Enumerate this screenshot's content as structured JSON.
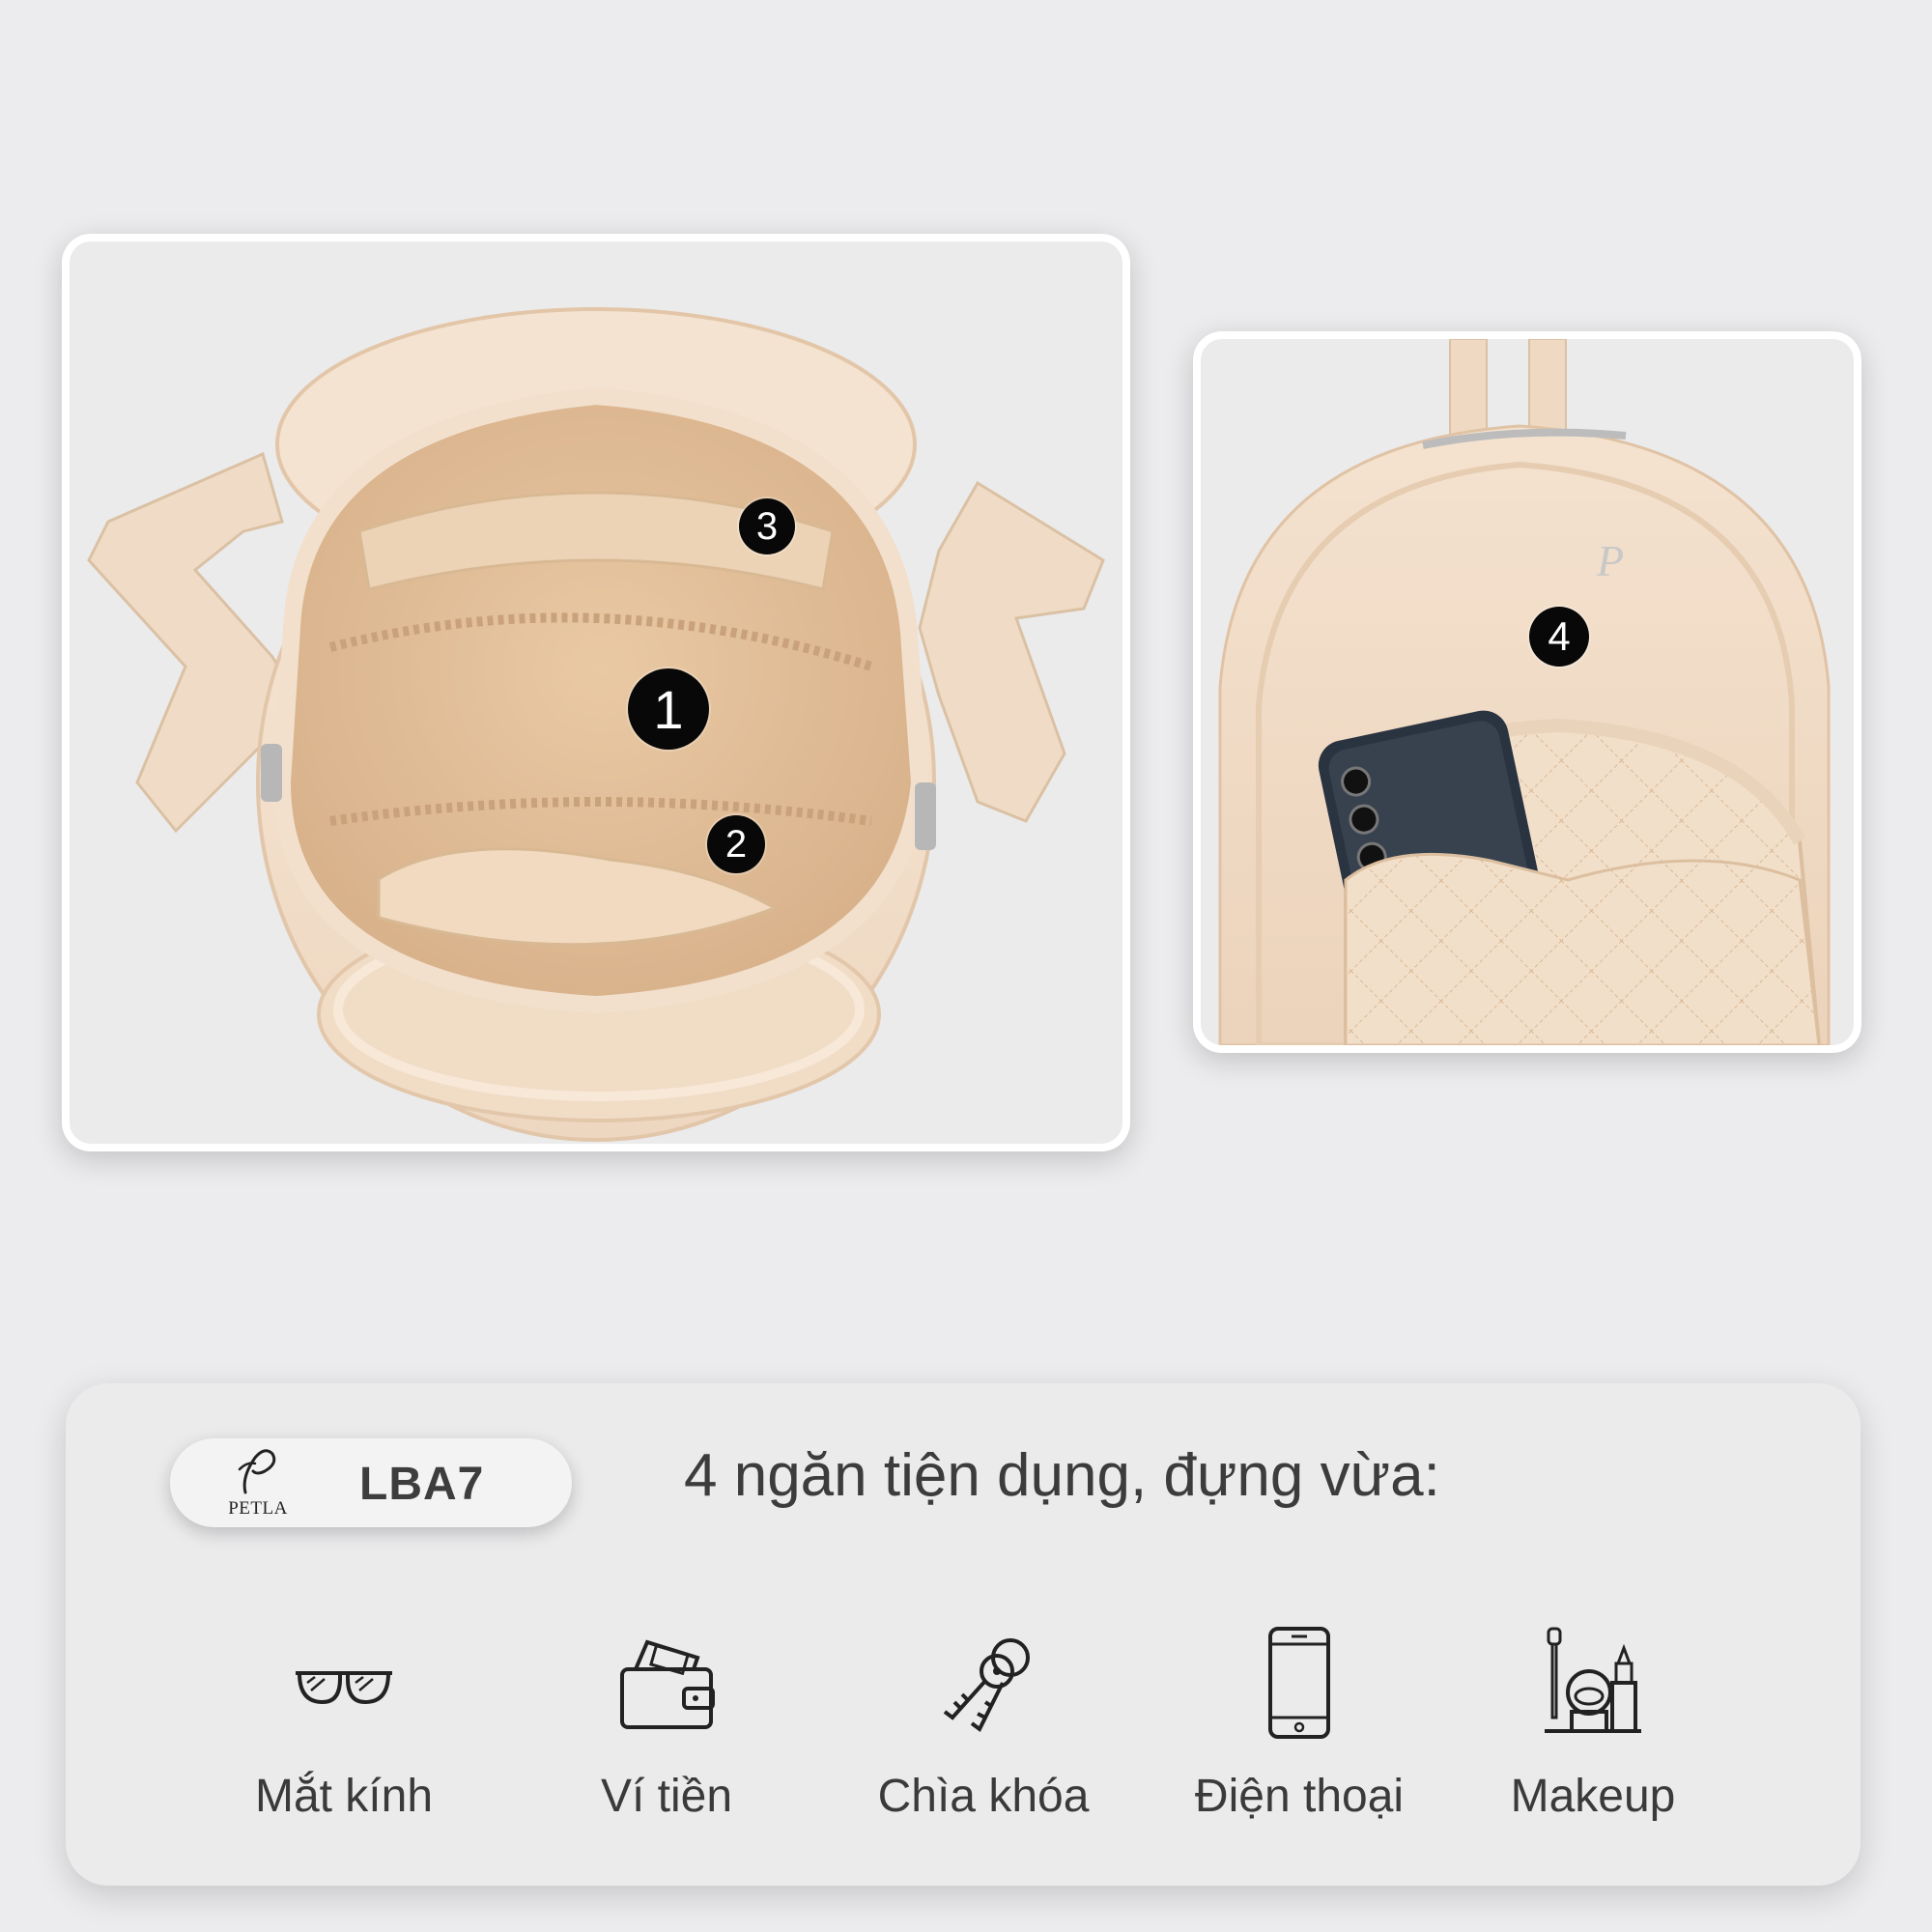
{
  "photos": {
    "interior": {
      "markers": [
        "1",
        "2",
        "3"
      ]
    },
    "front": {
      "markers": [
        "4"
      ]
    }
  },
  "brand": {
    "logo_text": "PETLA",
    "model_code": "LBA7"
  },
  "headline": "4 ngăn tiện dụng, đựng vừa:",
  "features": [
    {
      "icon": "glasses-icon",
      "label": "Mắt kính"
    },
    {
      "icon": "wallet-icon",
      "label": "Ví tiền"
    },
    {
      "icon": "keys-icon",
      "label": "Chìa khóa"
    },
    {
      "icon": "phone-icon",
      "label": "Điện thoại"
    },
    {
      "icon": "makeup-icon",
      "label": "Makeup"
    }
  ],
  "colors": {
    "background": "#ececee",
    "bag": "#f3ddc6",
    "lining": "#e2bf98",
    "marker": "#080808",
    "text": "#3c3c3c"
  }
}
